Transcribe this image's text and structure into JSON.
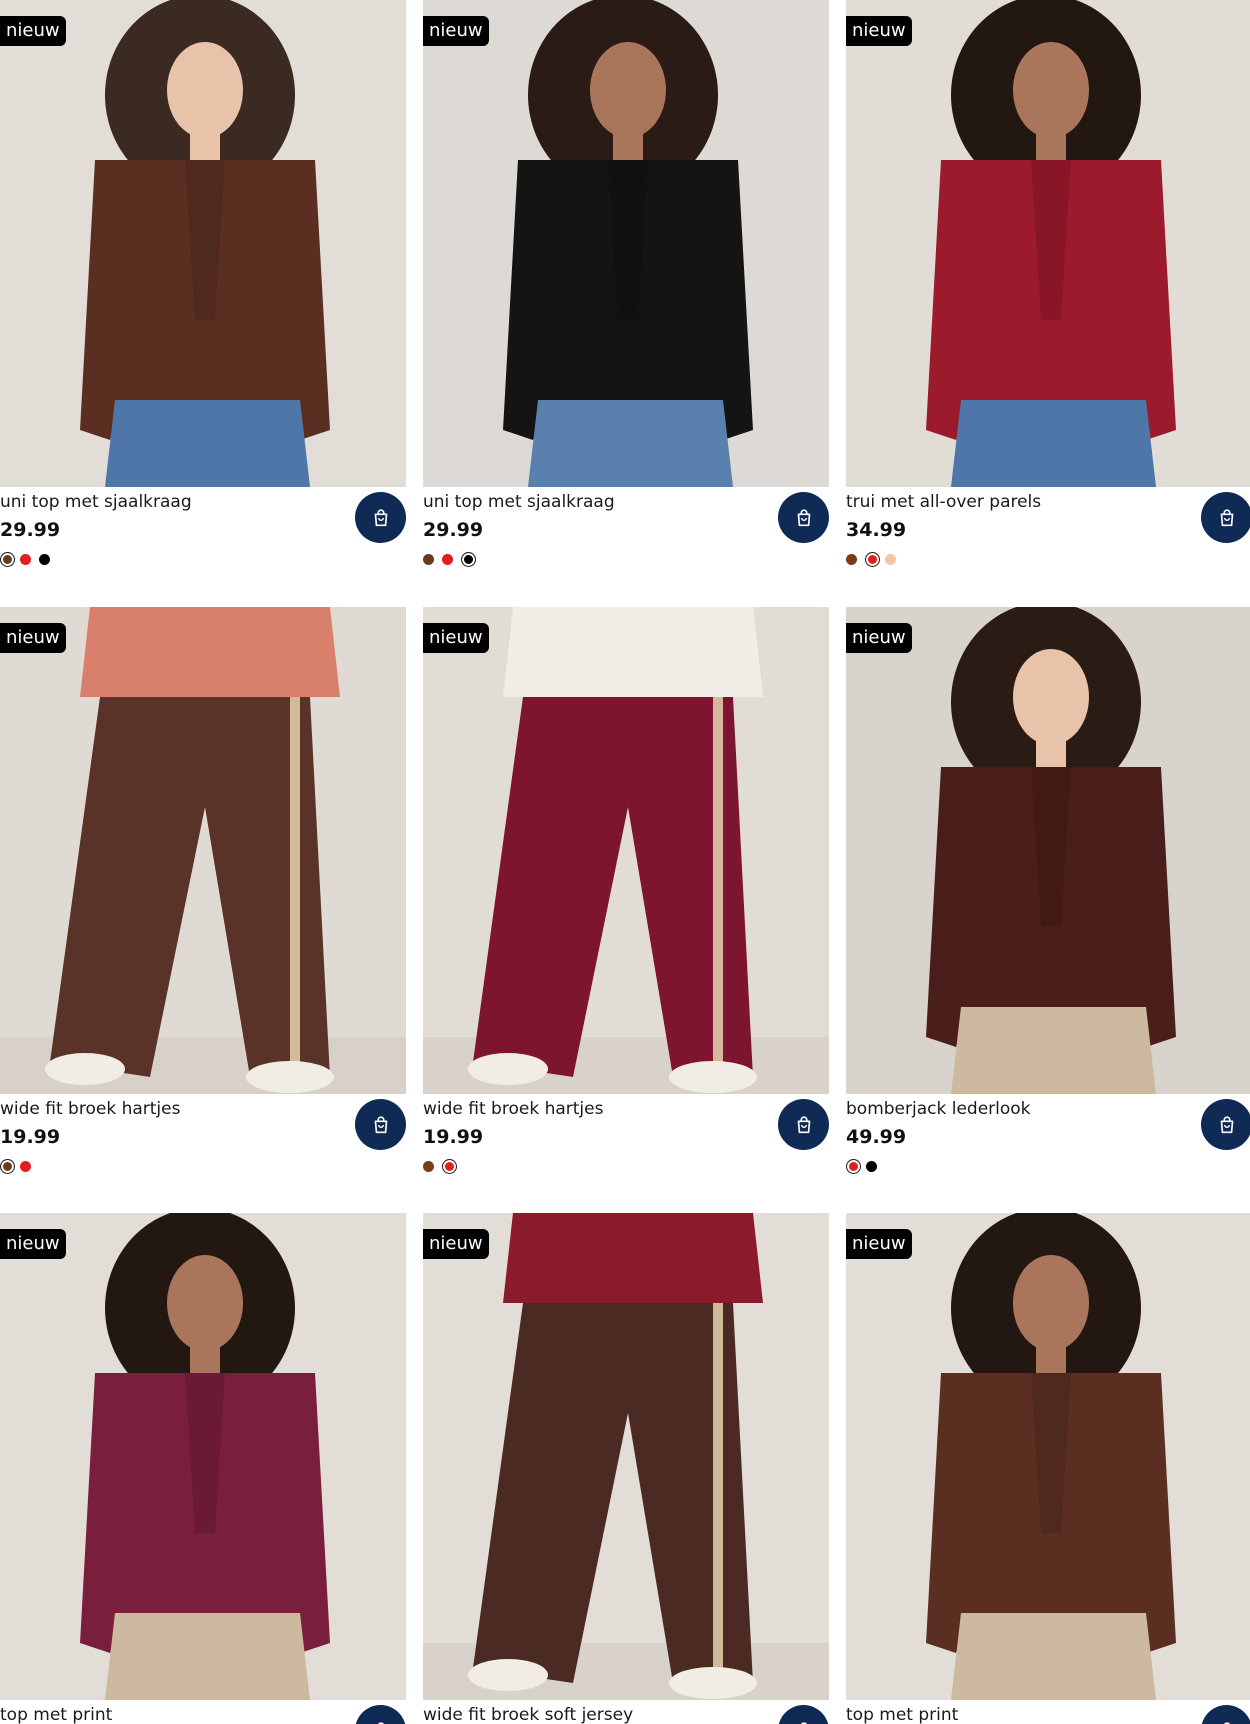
{
  "products": [
    {
      "badge": "nieuw",
      "title": "uni top met sjaalkraag",
      "price": "29.99",
      "bg": "#e3ddd7",
      "garment": "#5a2f22",
      "bottom": "#4f76a8",
      "hair": "#3a2a22",
      "skin": "#e9c2aa",
      "swatches": [
        "#6b3a1c",
        "#e02020",
        "#000000"
      ],
      "selected": 0,
      "kind": "top"
    },
    {
      "badge": "nieuw",
      "title": "uni top met sjaalkraag",
      "price": "29.99",
      "bg": "#ddd9d4",
      "garment": "#141414",
      "bottom": "#5a80ad",
      "hair": "#2a1b14",
      "skin": "#a9765c",
      "swatches": [
        "#6b3a1c",
        "#e02020",
        "#000000"
      ],
      "selected": 2,
      "kind": "top"
    },
    {
      "badge": "nieuw",
      "title": "trui met all-over parels",
      "price": "34.99",
      "bg": "#e1dcd6",
      "garment": "#9b1a2c",
      "bottom": "#4f76a8",
      "hair": "#231711",
      "skin": "#a9765c",
      "swatches": [
        "#7a3d14",
        "#e02020",
        "#f2c4a8"
      ],
      "selected": 1,
      "kind": "top"
    },
    {
      "badge": "nieuw",
      "title": "wide fit broek hartjes",
      "price": "19.99",
      "bg": "#e0dad4",
      "garment": "#5a3328",
      "bottom": "#5a3328",
      "hair": "#d9806d",
      "skin": "#e9c2aa",
      "swatches": [
        "#6b3a1c",
        "#e02020"
      ],
      "selected": 0,
      "kind": "pants"
    },
    {
      "badge": "nieuw",
      "title": "wide fit broek hartjes",
      "price": "19.99",
      "bg": "#e2dcd6",
      "garment": "#7e1530",
      "bottom": "#7e1530",
      "hair": "#f2ede6",
      "skin": "#e9c2aa",
      "swatches": [
        "#7a3d14",
        "#e02020"
      ],
      "selected": 1,
      "kind": "pants"
    },
    {
      "badge": "nieuw",
      "title": "bomberjack lederlook",
      "price": "49.99",
      "bg": "#d8d3cd",
      "garment": "#4a1e1a",
      "bottom": "#cdb9a0",
      "hair": "#2a1b14",
      "skin": "#e9c2aa",
      "swatches": [
        "#e02020",
        "#000000"
      ],
      "selected": 0,
      "kind": "top"
    },
    {
      "badge": "nieuw",
      "title": "top met print",
      "price": "",
      "bg": "#e2ddd7",
      "garment": "#7a1e3e",
      "bottom": "#cdb9a0",
      "hair": "#231711",
      "skin": "#a9765c",
      "swatches": [],
      "selected": -1,
      "kind": "top"
    },
    {
      "badge": "nieuw",
      "title": "wide fit broek soft jersey",
      "price": "",
      "bg": "#e3ddd7",
      "garment": "#4a2a22",
      "bottom": "#4a2a22",
      "hair": "#8a1a2c",
      "skin": "#e9c2aa",
      "swatches": [],
      "selected": -1,
      "kind": "pants"
    },
    {
      "badge": "nieuw",
      "title": "top met print",
      "price": "",
      "bg": "#e2ddd7",
      "garment": "#5a2f22",
      "bottom": "#cdb9a0",
      "hair": "#231711",
      "skin": "#a9765c",
      "swatches": [],
      "selected": -1,
      "kind": "top"
    }
  ],
  "icons": {
    "cart": "shopping-bag-icon"
  },
  "colors": {
    "cart_bg": "#0e2a55",
    "badge_bg": "#000000"
  }
}
